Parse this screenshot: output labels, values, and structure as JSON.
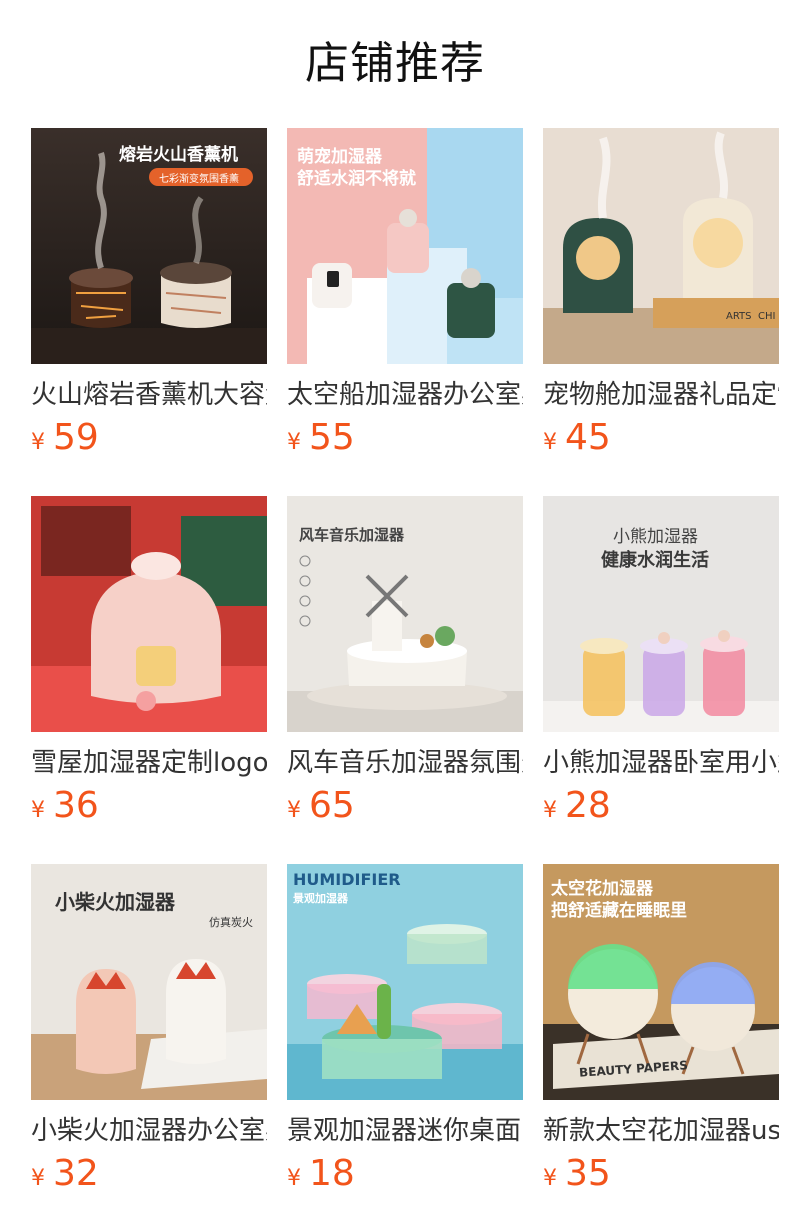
{
  "header": {
    "title": "店铺推荐"
  },
  "currency": "¥",
  "products": [
    {
      "name": "火山熔岩香薰机大容量",
      "price": "59",
      "image_text": [
        "熔岩火山香薰机",
        "七彩渐变氛围香薰"
      ]
    },
    {
      "name": "太空船加湿器办公室桌面",
      "price": "55",
      "image_text": [
        "萌宠加湿器",
        "舒适水润不将就"
      ]
    },
    {
      "name": "宠物舱加湿器礼品定制",
      "price": "45",
      "image_text": [
        "ARTS",
        "CHI"
      ]
    },
    {
      "name": "雪屋加湿器定制logo",
      "price": "36",
      "image_text": []
    },
    {
      "name": "风车音乐加湿器氛围灯",
      "price": "65",
      "image_text": [
        "风车音乐加湿器"
      ]
    },
    {
      "name": "小熊加湿器卧室用小型",
      "price": "28",
      "image_text": [
        "小熊加湿器",
        "健康水润生活"
      ]
    },
    {
      "name": "小柴火加湿器办公室桌面",
      "price": "32",
      "image_text": [
        "小柴火加湿器",
        "仿真炭火"
      ]
    },
    {
      "name": "景观加湿器迷你桌面",
      "price": "18",
      "image_text": [
        "HUMIDIFIER",
        "景观加湿器"
      ]
    },
    {
      "name": "新款太空花加湿器usb",
      "price": "35",
      "image_text": [
        "太空花加湿器",
        "把舒适藏在睡眠里",
        "BEAUTY PAPERS"
      ]
    }
  ],
  "colors": {
    "price": "#f2541b",
    "title": "#111111",
    "name": "#333333"
  }
}
